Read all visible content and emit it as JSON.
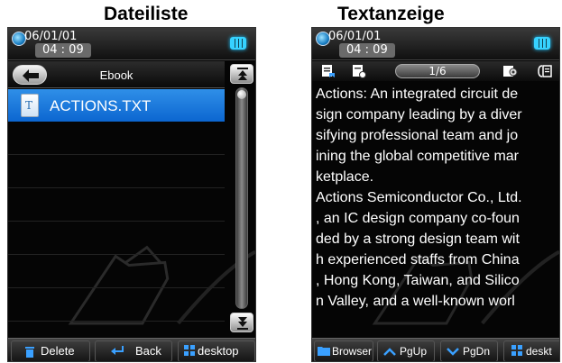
{
  "captions": {
    "left": "Dateiliste",
    "right": "Textanzeige"
  },
  "status": {
    "date": "06/01/01",
    "time": "04 : 09"
  },
  "file_browser": {
    "folder_title": "Ebook",
    "files": [
      {
        "name": "ACTIONS.TXT",
        "selected": true
      }
    ],
    "bottom_buttons": {
      "delete": "Delete",
      "back": "Back",
      "desktop": "desktop"
    }
  },
  "text_viewer": {
    "page_counter": "1/6",
    "lines": [
      "Actions: An integrated circuit de",
      "sign company leading by a diver",
      "sifying professional team and jo",
      "ining the global competitive mar",
      "ketplace.",
      "Actions Semiconductor Co., Ltd.",
      ", an IC design company co-foun",
      "ded by a strong design team wit",
      "h experienced staffs from China",
      ", Hong Kong, Taiwan, and Silico",
      "n Valley, and a well-known worl"
    ],
    "bottom_buttons": {
      "browser": "Browser",
      "pgup": "PgUp",
      "pgdn": "PgDn",
      "desktop": "deskt"
    }
  },
  "colors": {
    "accent": "#1e7de0",
    "battery": "#36d2ff",
    "background": "#050505"
  }
}
